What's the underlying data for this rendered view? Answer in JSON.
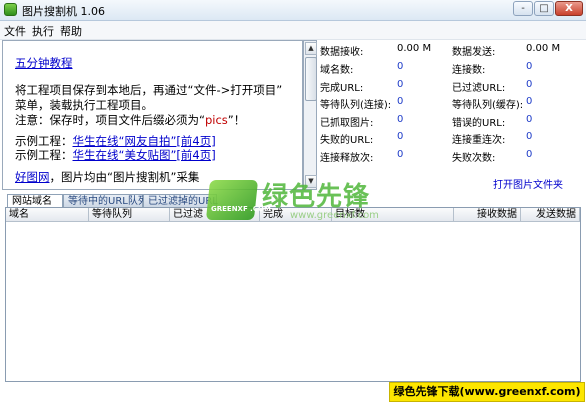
{
  "window": {
    "title": "图片搜割机 1.06",
    "minimize_label": "-",
    "maximize_label": "□",
    "close_label": "X"
  },
  "menu": [
    "文件",
    "执行",
    "帮助"
  ],
  "intro": {
    "tutorial_link": "五分钟教程",
    "line1": "将工程项目保存到本地后，再通过“文件->打开项目”",
    "line2": "菜单，装载执行工程项目。",
    "line3_prefix": "注意：保存时，项目文件后缀必须为“",
    "line3_ext": "pics",
    "line3_suffix": "”！",
    "example_label": "示例工程：",
    "example1_link": "华生在线“网友自拍”[前4页]",
    "example2_link": "华生在线“美女贴图”[前4页]",
    "good_site_link": "好图网",
    "good_site_text": "，图片均由“图片搜割机”采集"
  },
  "stats": [
    {
      "label": "数据接收:",
      "value": "0.00 M"
    },
    {
      "label": "数据发送:",
      "value": "0.00 M"
    },
    {
      "label": "域名数:",
      "value": "0"
    },
    {
      "label": "连接数:",
      "value": "0"
    },
    {
      "label": "完成URL:",
      "value": "0"
    },
    {
      "label": "已过滤URL:",
      "value": "0"
    },
    {
      "label": "等待队列(连接):",
      "value": "0"
    },
    {
      "label": "等待队列(缓存):",
      "value": "0"
    },
    {
      "label": "已抓取图片:",
      "value": "0"
    },
    {
      "label": "错误的URL:",
      "value": "0"
    },
    {
      "label": "失败的URL:",
      "value": "0"
    },
    {
      "label": "连接重连次:",
      "value": "0"
    },
    {
      "label": "连接释放次:",
      "value": "0"
    },
    {
      "label": "失败次数:",
      "value": "0"
    }
  ],
  "open_folder": "打开图片文件夹",
  "tabs": [
    "网站域名",
    "等待中的URL队列",
    "已过滤掉的URL"
  ],
  "columns": [
    "域名",
    "等待队列",
    "已过滤",
    "完成",
    "目标数",
    "接收数据",
    "发送数据"
  ],
  "watermark": {
    "brand": "绿色先锋",
    "sub": "GREENXF .COM",
    "url": "www.greenxf.com"
  },
  "banner": "绿色先锋下载(www.greenxf.com)"
}
